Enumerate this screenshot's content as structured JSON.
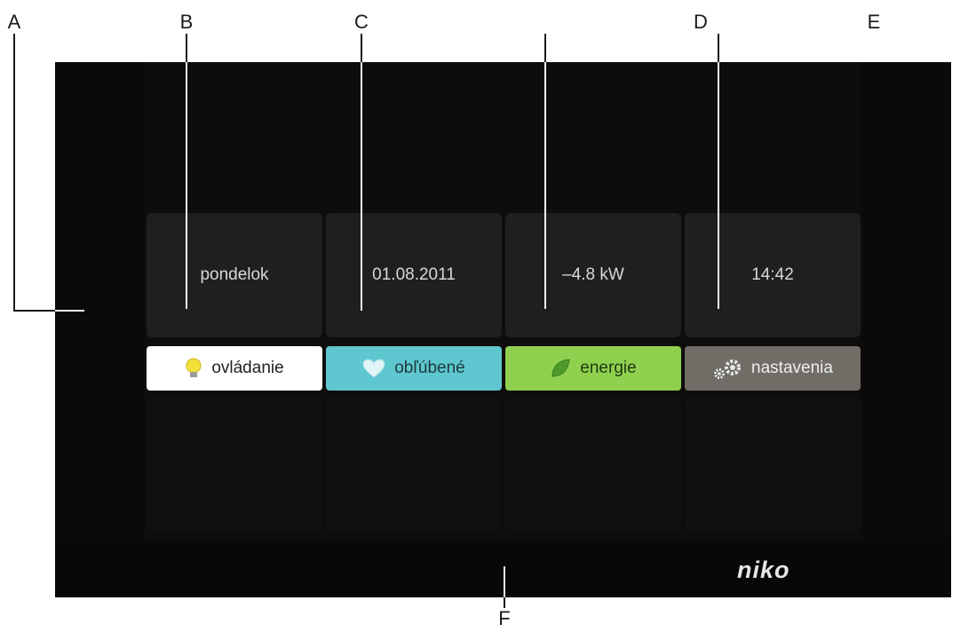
{
  "callouts": {
    "a": "A",
    "b": "B",
    "c": "C",
    "d": "D",
    "e": "E",
    "f": "F"
  },
  "info": {
    "day": "pondelok",
    "date": "01.08.2011",
    "power": "–4.8 kW",
    "time": "14:42"
  },
  "nav": {
    "control": "ovládanie",
    "favorites": "obľúbené",
    "energy": "energie",
    "settings": "nastavenia"
  },
  "brand": {
    "logo": "niko"
  },
  "colors": {
    "control_bg": "#ffffff",
    "favorites_bg": "#5ec7cf",
    "energy_bg": "#8fd14f",
    "settings_bg": "#6f6d66",
    "screen_bg": "#0c0a09"
  },
  "icons": {
    "control": "lightbulb-icon",
    "favorites": "heart-icon",
    "energy": "leaf-icon",
    "settings": "gears-icon"
  }
}
